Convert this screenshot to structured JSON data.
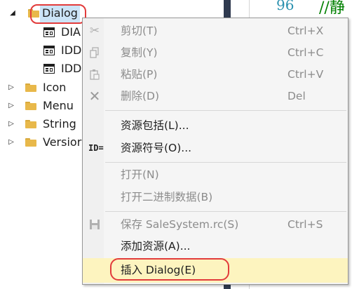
{
  "tree": {
    "items": [
      {
        "label": "Dialog",
        "expanded": true,
        "selected": true,
        "icon": "folder-icon"
      },
      {
        "label": "DIA",
        "icon": "dialog-resource-icon"
      },
      {
        "label": "IDD",
        "icon": "dialog-resource-icon"
      },
      {
        "label": "IDD",
        "icon": "dialog-resource-icon"
      },
      {
        "label": "Icon",
        "icon": "folder-icon"
      },
      {
        "label": "Menu",
        "icon": "folder-icon"
      },
      {
        "label": "String",
        "icon": "folder-icon"
      },
      {
        "label": "Versior",
        "icon": "folder-icon"
      }
    ],
    "arrow_expanded": "◢",
    "arrow_collapsed": "▷"
  },
  "editor": {
    "line_number": "96",
    "comment_text": "//静"
  },
  "menu": {
    "items": [
      {
        "label": "剪切(T)",
        "shortcut": "Ctrl+X",
        "disabled": true,
        "icon": "cut-icon"
      },
      {
        "label": "复制(Y)",
        "shortcut": "Ctrl+C",
        "disabled": true,
        "icon": "copy-icon"
      },
      {
        "label": "粘贴(P)",
        "shortcut": "Ctrl+V",
        "disabled": true,
        "icon": "paste-icon"
      },
      {
        "label": "删除(D)",
        "shortcut": "Del",
        "disabled": true,
        "icon": "delete-icon"
      },
      {
        "label": "资源包括(L)...",
        "shortcut": "",
        "disabled": false,
        "icon": ""
      },
      {
        "label": "资源符号(O)...",
        "shortcut": "",
        "disabled": false,
        "icon": "resource-symbol-icon",
        "icon_text": "ID="
      },
      {
        "label": "打开(N)",
        "shortcut": "",
        "disabled": true,
        "icon": ""
      },
      {
        "label": "打开二进制数据(B)",
        "shortcut": "",
        "disabled": true,
        "icon": ""
      },
      {
        "label": "保存 SaleSystem.rc(S)",
        "shortcut": "Ctrl+S",
        "disabled": true,
        "icon": "save-icon"
      },
      {
        "label": "添加资源(A)...",
        "shortcut": "",
        "disabled": false,
        "icon": ""
      },
      {
        "label": "插入 Dialog(E)",
        "shortcut": "",
        "disabled": false,
        "highlighted": true,
        "icon": ""
      }
    ]
  },
  "colors": {
    "selection": "#cce4f7",
    "highlight": "#fdf4bf",
    "annotation_red": "#e23b3b",
    "line_number": "#2b91af",
    "comment": "#008000"
  }
}
